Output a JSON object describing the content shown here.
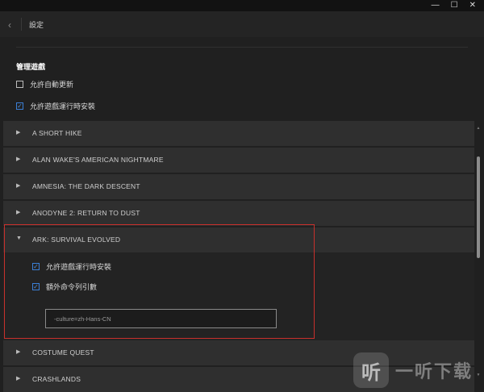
{
  "window": {
    "controls": [
      "—",
      "☐",
      "✕"
    ]
  },
  "header": {
    "back_icon": "chevron-left-icon",
    "title": "設定"
  },
  "manage_games": {
    "heading": "管理遊戲",
    "options": [
      {
        "label": "允許自動更新",
        "checked": false
      },
      {
        "label": "允許遊戲運行時安裝",
        "checked": true
      }
    ]
  },
  "games": [
    {
      "name": "A SHORT HIKE",
      "expanded": false
    },
    {
      "name": "ALAN WAKE'S AMERICAN NIGHTMARE",
      "expanded": false
    },
    {
      "name": "AMNESIA: THE DARK DESCENT",
      "expanded": false
    },
    {
      "name": "ANODYNE 2: RETURN TO DUST",
      "expanded": false
    },
    {
      "name": "ARK: SURVIVAL EVOLVED",
      "expanded": true
    },
    {
      "name": "COSTUME QUEST",
      "expanded": false
    },
    {
      "name": "CRASHLANDS",
      "expanded": false
    }
  ],
  "ark_settings": {
    "options": [
      {
        "label": "允許遊戲運行時安裝",
        "checked": true
      },
      {
        "label": "額外命令列引數",
        "checked": true
      }
    ],
    "args_value": "-culture=zh-Hans-CN"
  },
  "watermark": {
    "logo_char": "听",
    "text": "一听下载"
  },
  "colors": {
    "accent": "#3b7fd6",
    "highlight": "#c8302c",
    "row_bg": "#2f2f2f",
    "page_bg": "#202020"
  }
}
